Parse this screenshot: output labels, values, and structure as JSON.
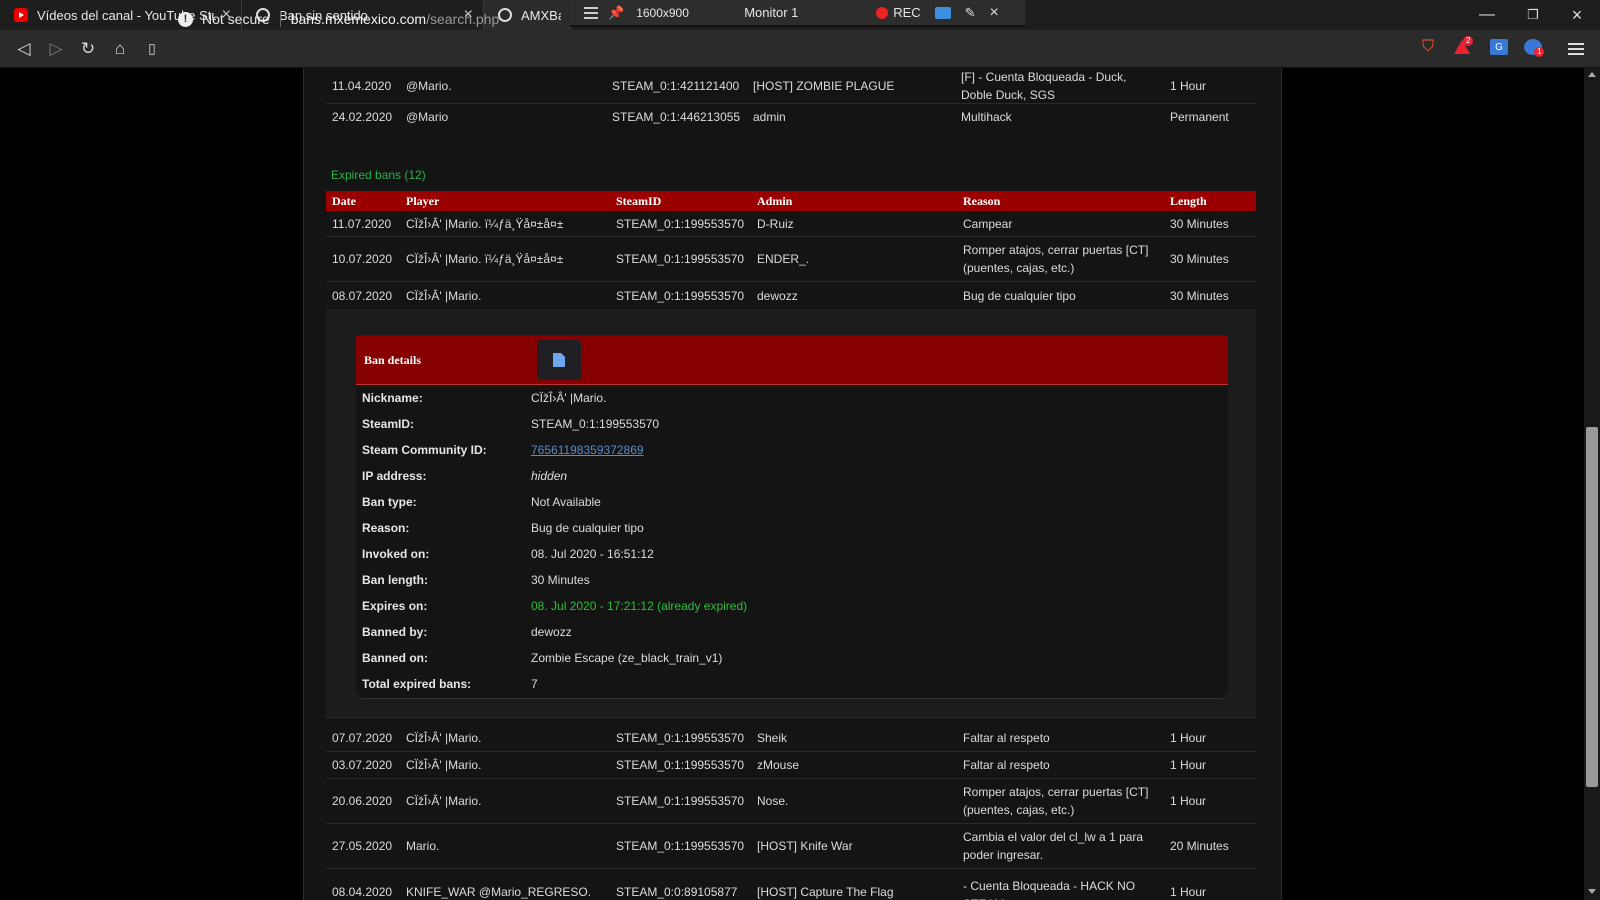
{
  "tabs": [
    {
      "title": "Vídeos del canal - YouTube Studio",
      "icon": "youtube-icon"
    },
    {
      "title": "Ban sin sentido",
      "icon": "globe-icon"
    },
    {
      "title": "AMXBans",
      "icon": "globe-icon"
    }
  ],
  "recorder": {
    "resolution": "1600x900",
    "monitor": "Monitor 1",
    "rec_label": "REC"
  },
  "address": {
    "security": "Not secure",
    "host": "bans.mxemexico.com",
    "path": "/search.php"
  },
  "extensions": {
    "adblock_badge": "2",
    "user_badge": "1"
  },
  "active_bans": [
    {
      "date": "11.04.2020",
      "player": "@Mario.",
      "steamid": "STEAM_0:1:421121400",
      "admin": "[HOST] ZOMBIE PLAGUE",
      "reason": "[F] - Cuenta Bloqueada - Duck, Doble Duck, SGS",
      "length": "1 Hour"
    },
    {
      "date": "24.02.2020",
      "player": "@Mario",
      "steamid": "STEAM_0:1:446213055",
      "admin": "admin",
      "reason": "Multihack",
      "length": "Permanent"
    }
  ],
  "expired_title": "Expired bans (12)",
  "columns": {
    "date": "Date",
    "player": "Player",
    "steamid": "SteamID",
    "admin": "Admin",
    "reason": "Reason",
    "length": "Length"
  },
  "expired_bans": [
    {
      "date": "11.07.2020",
      "player": "CÏžÎ›Â' |Mario. ï¼ƒä¸Ÿå¤±å¤±",
      "steamid": "STEAM_0:1:199553570",
      "admin": "D-Ruiz",
      "reason": "Campear",
      "length": "30 Minutes"
    },
    {
      "date": "10.07.2020",
      "player": "CÏžÎ›Â' |Mario. ï¼ƒä¸Ÿå¤±å¤±",
      "steamid": "STEAM_0:1:199553570",
      "admin": "ENDER_.",
      "reason": "Romper atajos, cerrar puertas [CT] (puentes, cajas, etc.)",
      "length": "30 Minutes"
    },
    {
      "date": "08.07.2020",
      "player": "CÏžÎ›Â' |Mario.",
      "steamid": "STEAM_0:1:199553570",
      "admin": "dewozz",
      "reason": "Bug de cualquier tipo",
      "length": "30 Minutes"
    },
    {
      "date": "07.07.2020",
      "player": "CÏžÎ›Â' |Mario.",
      "steamid": "STEAM_0:1:199553570",
      "admin": "Sheik",
      "reason": "Faltar al respeto",
      "length": "1 Hour"
    },
    {
      "date": "03.07.2020",
      "player": "CÏžÎ›Â' |Mario.",
      "steamid": "STEAM_0:1:199553570",
      "admin": "zMouse",
      "reason": "Faltar al respeto",
      "length": "1 Hour"
    },
    {
      "date": "20.06.2020",
      "player": "CÏžÎ›Â' |Mario.",
      "steamid": "STEAM_0:1:199553570",
      "admin": "Nose.",
      "reason": "Romper atajos, cerrar puertas [CT] (puentes, cajas, etc.)",
      "length": "1 Hour"
    },
    {
      "date": "27.05.2020",
      "player": "Mario.",
      "steamid": "STEAM_0:1:199553570",
      "admin": "[HOST] Knife War",
      "reason": "Cambia el valor del cl_lw a 1 para poder ingresar.",
      "length": "20 Minutes"
    },
    {
      "date": "08.04.2020",
      "player": "KNIFE_WAR @Mario_REGRESO.",
      "steamid": "STEAM_0:0:89105877",
      "admin": "[HOST] Capture The Flag",
      "reason": "- Cuenta Bloqueada - HACK NO STEAM",
      "length": "1 Hour"
    }
  ],
  "details": {
    "title": "Ban details",
    "fields": [
      {
        "label": "Nickname:",
        "value": "CÏžÎ›Â' |Mario."
      },
      {
        "label": "SteamID:",
        "value": "STEAM_0:1:199553570"
      },
      {
        "label": "Steam Community ID:",
        "value": "76561198359372869"
      },
      {
        "label": "IP address:",
        "value": "hidden"
      },
      {
        "label": "Ban type:",
        "value": "Not Available"
      },
      {
        "label": "Reason:",
        "value": "Bug de cualquier tipo"
      },
      {
        "label": "Invoked on:",
        "value": "08. Jul 2020 - 16:51:12"
      },
      {
        "label": "Ban length:",
        "value": "30 Minutes"
      },
      {
        "label": "Expires on:",
        "value": "08. Jul 2020 - 17:21:12 (already expired)"
      },
      {
        "label": "Banned by:",
        "value": "dewozz"
      },
      {
        "label": "Banned on:",
        "value": "Zombie Escape (ze_black_train_v1)"
      },
      {
        "label": "Total expired bans:",
        "value": "7"
      }
    ]
  },
  "colors": {
    "header_red": "#9a0000",
    "details_red": "#870000",
    "section_green": "#2bb24c",
    "expired_green": "#2fbf3d"
  }
}
